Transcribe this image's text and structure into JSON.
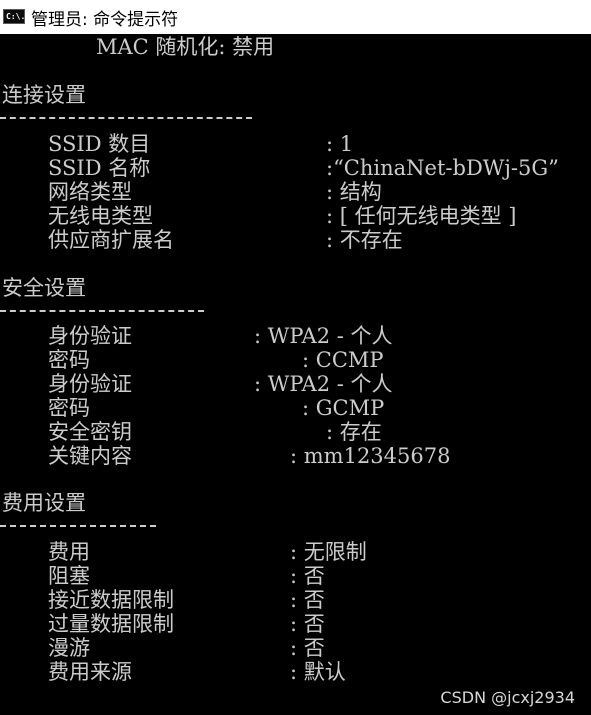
{
  "window": {
    "icon_text": "C:\\.",
    "title": "管理员: 命令提示符"
  },
  "console": {
    "mac_line": "MAC 随机化: 禁用",
    "connection": {
      "heading": "连接设置",
      "rows": [
        {
          "label": "SSID 数目",
          "value": ": 1"
        },
        {
          "label": "SSID 名称",
          "value": ":“ChinaNet-bDWj-5G”"
        },
        {
          "label": "网络类型",
          "value": ": 结构"
        },
        {
          "label": "无线电类型",
          "value": ": [ 任何无线电类型 ]"
        },
        {
          "label": "供应商扩展名",
          "value": ": 不存在"
        }
      ]
    },
    "security": {
      "heading": "安全设置",
      "rows": [
        {
          "label": "身份验证",
          "value": ": WPA2 - 个人"
        },
        {
          "label": "密码",
          "value": ": CCMP"
        },
        {
          "label": "身份验证",
          "value": ": WPA2 - 个人"
        },
        {
          "label": "密码",
          "value": ": GCMP"
        },
        {
          "label": "安全密钥",
          "value": ": 存在"
        },
        {
          "label": "关键内容",
          "value": ": mm12345678"
        }
      ]
    },
    "cost": {
      "heading": "费用设置",
      "rows": [
        {
          "label": "费用",
          "value": ": 无限制"
        },
        {
          "label": "阻塞",
          "value": ": 否"
        },
        {
          "label": "接近数据限制",
          "value": ": 否"
        },
        {
          "label": "过量数据限制",
          "value": ": 否"
        },
        {
          "label": "漫游",
          "value": ": 否"
        },
        {
          "label": "费用来源",
          "value": ": 默认"
        }
      ]
    }
  },
  "watermark": "CSDN @jcxj2934"
}
